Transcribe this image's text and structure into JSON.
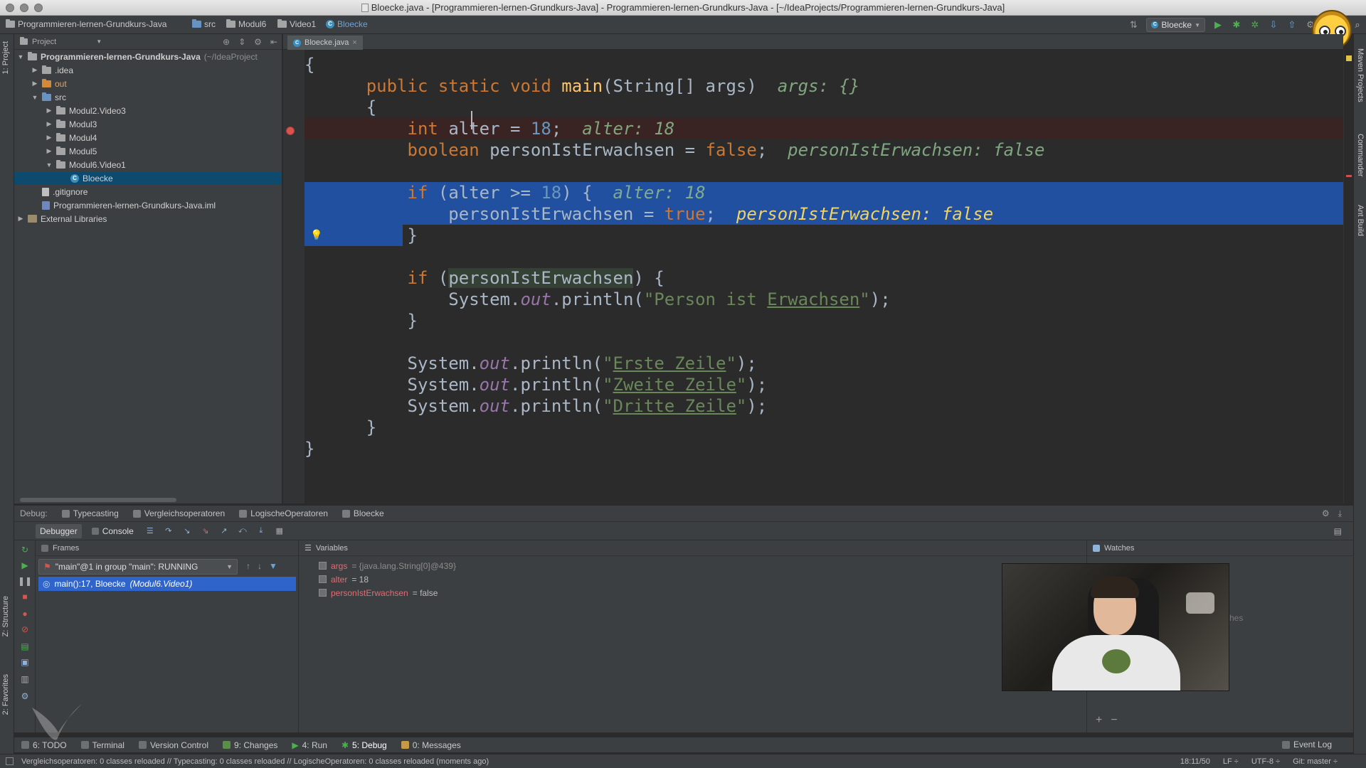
{
  "window": {
    "title": "Bloecke.java - [Programmieren-lernen-Grundkurs-Java] - Programmieren-lernen-Grundkurs-Java - [~/IdeaProjects/Programmieren-lernen-Grundkurs-Java]"
  },
  "breadcrumbs": [
    "Programmieren-lernen-Grundkurs-Java",
    "src",
    "Modul6",
    "Video1",
    "Bloecke"
  ],
  "run_config": "Bloecke",
  "left_strip": {
    "project_tab": "1: Project",
    "structure_tab": "Z: Structure",
    "favorites_tab": "2: Favorites"
  },
  "right_strip": {
    "maven": "Maven Projects",
    "commander": "Commander",
    "ant": "Ant Build"
  },
  "project_panel": {
    "header": "Project",
    "tree": [
      {
        "label": "Programmieren-lernen-Grundkurs-Java",
        "suffix": "(~/IdeaProject",
        "level": 0,
        "arrow": "▼",
        "icon": "folder"
      },
      {
        "label": ".idea",
        "level": 1,
        "arrow": "▶",
        "icon": "folder"
      },
      {
        "label": "out",
        "level": 1,
        "arrow": "▶",
        "icon": "folder-orange"
      },
      {
        "label": "src",
        "level": 1,
        "arrow": "▼",
        "icon": "folder-blue"
      },
      {
        "label": "Modul2.Video3",
        "level": 2,
        "arrow": "▶",
        "icon": "package"
      },
      {
        "label": "Modul3",
        "level": 2,
        "arrow": "▶",
        "icon": "package"
      },
      {
        "label": "Modul4",
        "level": 2,
        "arrow": "▶",
        "icon": "package"
      },
      {
        "label": "Modul5",
        "level": 2,
        "arrow": "▶",
        "icon": "package"
      },
      {
        "label": "Modul6.Video1",
        "level": 2,
        "arrow": "▼",
        "icon": "package"
      },
      {
        "label": "Bloecke",
        "level": 3,
        "arrow": "",
        "icon": "class",
        "selected": true
      },
      {
        "label": ".gitignore",
        "level": 1,
        "arrow": "",
        "icon": "file"
      },
      {
        "label": "Programmieren-lernen-Grundkurs-Java.iml",
        "level": 1,
        "arrow": "",
        "icon": "iml"
      },
      {
        "label": "External Libraries",
        "level": 0,
        "arrow": "▶",
        "icon": "library"
      }
    ]
  },
  "editor": {
    "tab_label": "Bloecke.java",
    "tab_close": "×",
    "code": {
      "l1": "{",
      "l2_kw1": "public",
      "l2_kw2": "static",
      "l2_kw3": "void",
      "l2_fn": "main",
      "l2_rest": "(String[] args)",
      "l2_hint": "args: {}",
      "l3": "{",
      "l4_kw": "int",
      "l4_var": "alter",
      "l4_eq": " = ",
      "l4_num": "18",
      "l4_end": ";",
      "l4_hint": "alter: 18",
      "l5_kw": "boolean",
      "l5_var": "personIstErwachsen",
      "l5_eq": " = ",
      "l5_val": "false",
      "l5_end": ";",
      "l5_hint": "personIstErwachsen: false",
      "l6_kw": "if",
      "l6_open": " (",
      "l6_cond_var": "alter",
      "l6_cond_op": " >= ",
      "l6_cond_num": "18",
      "l6_close": ") ",
      "l6_brace": "{",
      "l6_hint": "alter: 18",
      "l7_var": "personIstErwachsen",
      "l7_eq": " = ",
      "l7_val": "true",
      "l7_end": ";",
      "l7_hint": "personIstErwachsen: false",
      "l8": "}",
      "l9_kw": "if",
      "l9_open": " (",
      "l9_var": "personIstErwachsen",
      "l9_close": ") {",
      "l10_obj": "System.",
      "l10_field": "out",
      "l10_call": ".println(",
      "l10_str1": "\"Person ist ",
      "l10_str2": "Erwachsen",
      "l10_str3": "\"",
      "l10_end": ");",
      "l11": "}",
      "l12_obj": "System.",
      "l12_field": "out",
      "l12_call": ".println(",
      "l12_str1": "\"",
      "l12_str2": "Erste Zeile",
      "l12_str3": "\"",
      "l12_end": ");",
      "l13_obj": "System.",
      "l13_field": "out",
      "l13_call": ".println(",
      "l13_str1": "\"",
      "l13_str2": "Zweite Zeile",
      "l13_str3": "\"",
      "l13_end": ");",
      "l14_obj": "System.",
      "l14_field": "out",
      "l14_call": ".println(",
      "l14_str1": "\"",
      "l14_str2": "Dritte Zeile",
      "l14_str3": "\"",
      "l14_end": ");",
      "l15": "}",
      "l16": "}"
    }
  },
  "debug": {
    "label": "Debug:",
    "tabs": [
      "Typecasting",
      "Vergleichsoperatoren",
      "LogischeOperatoren",
      "Bloecke"
    ],
    "subtabs": {
      "debugger": "Debugger",
      "console": "Console"
    },
    "frames": {
      "title": "Frames",
      "thread": "\"main\"@1 in group \"main\": RUNNING",
      "frame_main": "main():17, Bloecke",
      "frame_pkg": "(Modul6.Video1)"
    },
    "variables": {
      "title": "Variables",
      "items": [
        {
          "name": "args",
          "value": " = {java.lang.String[0]@439}",
          "dim": true
        },
        {
          "name": "alter",
          "value": " = 18",
          "dim": false
        },
        {
          "name": "personIstErwachsen",
          "value": " = false",
          "dim": false
        }
      ]
    },
    "watches": {
      "title": "Watches",
      "dim_text": "hes",
      "add": "+",
      "remove": "−"
    }
  },
  "toolstrip": {
    "todo": "6: TODO",
    "terminal": "Terminal",
    "vcs": "Version Control",
    "changes": "9: Changes",
    "run": "4: Run",
    "debug": "5: Debug",
    "messages": "0: Messages",
    "event_log": "Event Log"
  },
  "statusbar": {
    "message": "Vergleichsoperatoren: 0 classes reloaded // Typecasting: 0 classes reloaded // LogischeOperatoren: 0 classes reloaded (moments ago)",
    "position": "18:11/50",
    "line_sep": "LF ÷",
    "encoding": "UTF-8 ÷",
    "git": "Git: master ÷"
  }
}
